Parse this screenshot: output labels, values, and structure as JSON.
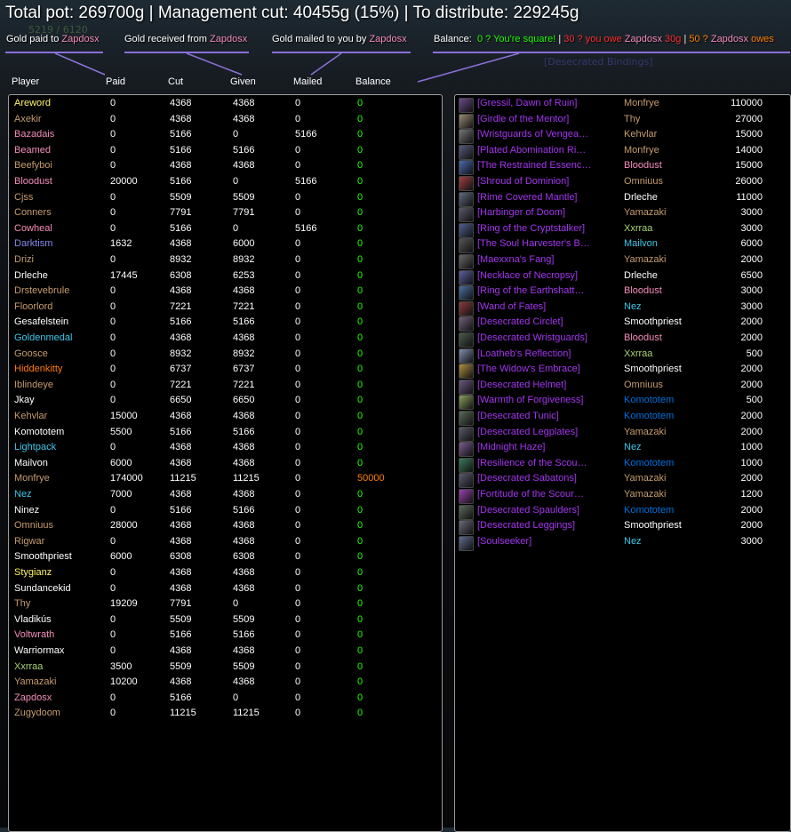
{
  "header": {
    "total_line": "Total pot: 269700g | Management cut: 40455g (15%) | To distribute: 229245g"
  },
  "legend": {
    "paid_label": "Gold paid to",
    "paid_name": "Zapdosx",
    "received_label": "Gold received from",
    "received_name": "Zapdosx",
    "mailed_label": "Gold mailed to you by",
    "mailed_name": "Zapdosx",
    "balance_label": "Balance:",
    "balance_square": "0 ? You're square!",
    "sep1": "|",
    "balance_owe_amount": "30 ? you owe",
    "balance_owe_name": "Zapdosx",
    "balance_owe_value": "30g",
    "sep2": "|",
    "balance_owes_amount": "50 ? ",
    "balance_owes_name": "Zapdosx",
    "balance_owes_word": "owes"
  },
  "faint_text": {
    "top_left": "5219 / 6120",
    "bg_item": "[Desecrated Bindings]"
  },
  "columns": [
    "Player",
    "Paid",
    "Cut",
    "Given",
    "Mailed",
    "Balance"
  ],
  "colors": {
    "legendary_orange": "#ff8000",
    "balance_green": "#1eff00",
    "epic_purple": "#a335ee",
    "panel_border": "#9a9a9a"
  },
  "players": [
    {
      "name": "Areword",
      "color": "#fff468",
      "paid": "0",
      "cut": "4368",
      "given": "4368",
      "mailed": "0",
      "balance": "0"
    },
    {
      "name": "Axekir",
      "color": "#c69b6d",
      "paid": "0",
      "cut": "4368",
      "given": "4368",
      "mailed": "0",
      "balance": "0"
    },
    {
      "name": "Bazadais",
      "color": "#f48cba",
      "paid": "0",
      "cut": "5166",
      "given": "0",
      "mailed": "5166",
      "balance": "0"
    },
    {
      "name": "Beamed",
      "color": "#f48cba",
      "paid": "0",
      "cut": "5166",
      "given": "5166",
      "mailed": "0",
      "balance": "0"
    },
    {
      "name": "Beefyboi",
      "color": "#c69b6d",
      "paid": "0",
      "cut": "4368",
      "given": "4368",
      "mailed": "0",
      "balance": "0"
    },
    {
      "name": "Bloodust",
      "color": "#f48cba",
      "paid": "20000",
      "cut": "5166",
      "given": "0",
      "mailed": "5166",
      "balance": "0"
    },
    {
      "name": "Cjss",
      "color": "#c69b6d",
      "paid": "0",
      "cut": "5509",
      "given": "5509",
      "mailed": "0",
      "balance": "0"
    },
    {
      "name": "Conners",
      "color": "#c69b6d",
      "paid": "0",
      "cut": "7791",
      "given": "7791",
      "mailed": "0",
      "balance": "0"
    },
    {
      "name": "Cowheal",
      "color": "#f48cba",
      "paid": "0",
      "cut": "5166",
      "given": "0",
      "mailed": "5166",
      "balance": "0"
    },
    {
      "name": "Darktism",
      "color": "#8788ee",
      "paid": "1632",
      "cut": "4368",
      "given": "6000",
      "mailed": "0",
      "balance": "0"
    },
    {
      "name": "Drizi",
      "color": "#c69b6d",
      "paid": "0",
      "cut": "8932",
      "given": "8932",
      "mailed": "0",
      "balance": "0"
    },
    {
      "name": "Drleche",
      "color": "#ffffff",
      "paid": "17445",
      "cut": "6308",
      "given": "6253",
      "mailed": "0",
      "balance": "0"
    },
    {
      "name": "Drstevebrule",
      "color": "#c69b6d",
      "paid": "0",
      "cut": "4368",
      "given": "4368",
      "mailed": "0",
      "balance": "0"
    },
    {
      "name": "Floorlord",
      "color": "#c69b6d",
      "paid": "0",
      "cut": "7221",
      "given": "7221",
      "mailed": "0",
      "balance": "0"
    },
    {
      "name": "Gesafelstein",
      "color": "#ffffff",
      "paid": "0",
      "cut": "5166",
      "given": "5166",
      "mailed": "0",
      "balance": "0"
    },
    {
      "name": "Goldenmedal",
      "color": "#3fc7eb",
      "paid": "0",
      "cut": "4368",
      "given": "4368",
      "mailed": "0",
      "balance": "0"
    },
    {
      "name": "Goosce",
      "color": "#c69b6d",
      "paid": "0",
      "cut": "8932",
      "given": "8932",
      "mailed": "0",
      "balance": "0"
    },
    {
      "name": "Hiddenkitty",
      "color": "#ff7c0a",
      "paid": "0",
      "cut": "6737",
      "given": "6737",
      "mailed": "0",
      "balance": "0"
    },
    {
      "name": "Iblindeye",
      "color": "#c69b6d",
      "paid": "0",
      "cut": "7221",
      "given": "7221",
      "mailed": "0",
      "balance": "0"
    },
    {
      "name": "Jkay",
      "color": "#ffffff",
      "paid": "0",
      "cut": "6650",
      "given": "6650",
      "mailed": "0",
      "balance": "0"
    },
    {
      "name": "Kehvlar",
      "color": "#c69b6d",
      "paid": "15000",
      "cut": "4368",
      "given": "4368",
      "mailed": "0",
      "balance": "0"
    },
    {
      "name": "Komototem",
      "color": "#ffffff",
      "paid": "5500",
      "cut": "5166",
      "given": "5166",
      "mailed": "0",
      "balance": "0"
    },
    {
      "name": "Lightpack",
      "color": "#3fc7eb",
      "paid": "0",
      "cut": "4368",
      "given": "4368",
      "mailed": "0",
      "balance": "0"
    },
    {
      "name": "Mailvon",
      "color": "#ffffff",
      "paid": "6000",
      "cut": "4368",
      "given": "4368",
      "mailed": "0",
      "balance": "0"
    },
    {
      "name": "Monfrye",
      "color": "#c69b6d",
      "paid": "174000",
      "cut": "11215",
      "given": "11215",
      "mailed": "0",
      "balance": "50000",
      "balance_color": "#ff8000"
    },
    {
      "name": "Nez",
      "color": "#3fc7eb",
      "paid": "7000",
      "cut": "4368",
      "given": "4368",
      "mailed": "0",
      "balance": "0"
    },
    {
      "name": "Ninez",
      "color": "#ffffff",
      "paid": "0",
      "cut": "5166",
      "given": "5166",
      "mailed": "0",
      "balance": "0"
    },
    {
      "name": "Omniuus",
      "color": "#c69b6d",
      "paid": "28000",
      "cut": "4368",
      "given": "4368",
      "mailed": "0",
      "balance": "0"
    },
    {
      "name": "Rigwar",
      "color": "#c69b6d",
      "paid": "0",
      "cut": "4368",
      "given": "4368",
      "mailed": "0",
      "balance": "0"
    },
    {
      "name": "Smoothpriest",
      "color": "#ffffff",
      "paid": "6000",
      "cut": "6308",
      "given": "6308",
      "mailed": "0",
      "balance": "0"
    },
    {
      "name": "Stygianz",
      "color": "#fff468",
      "paid": "0",
      "cut": "4368",
      "given": "4368",
      "mailed": "0",
      "balance": "0"
    },
    {
      "name": "Sundancekid",
      "color": "#ffffff",
      "paid": "0",
      "cut": "4368",
      "given": "4368",
      "mailed": "0",
      "balance": "0"
    },
    {
      "name": "Thy",
      "color": "#c69b6d",
      "paid": "19209",
      "cut": "7791",
      "given": "0",
      "mailed": "0",
      "balance": "0"
    },
    {
      "name": "Vladikús",
      "color": "#ffffff",
      "paid": "0",
      "cut": "5509",
      "given": "5509",
      "mailed": "0",
      "balance": "0"
    },
    {
      "name": "Voltwrath",
      "color": "#f48cba",
      "paid": "0",
      "cut": "5166",
      "given": "5166",
      "mailed": "0",
      "balance": "0"
    },
    {
      "name": "Warriormax",
      "color": "#ffffff",
      "paid": "0",
      "cut": "4368",
      "given": "4368",
      "mailed": "0",
      "balance": "0"
    },
    {
      "name": "Xxrraa",
      "color": "#aad372",
      "paid": "3500",
      "cut": "5509",
      "given": "5509",
      "mailed": "0",
      "balance": "0"
    },
    {
      "name": "Yamazaki",
      "color": "#c69b6d",
      "paid": "10200",
      "cut": "4368",
      "given": "4368",
      "mailed": "0",
      "balance": "0"
    },
    {
      "name": "Zapdosx",
      "color": "#f48cba",
      "paid": "0",
      "cut": "5166",
      "given": "0",
      "mailed": "0",
      "balance": "0"
    },
    {
      "name": "Zugydoom",
      "color": "#c69b6d",
      "paid": "0",
      "cut": "11215",
      "given": "11215",
      "mailed": "0",
      "balance": "0"
    }
  ],
  "items": [
    {
      "name": "[Gressil, Dawn of Ruin]",
      "icon": "sword-icon",
      "icon_color": "#6a4a8a",
      "owner": "Monfrye",
      "owner_color": "#c69b6d",
      "price": "110000"
    },
    {
      "name": "[Girdle of the Mentor]",
      "icon": "belt-icon",
      "icon_color": "#9a8a70",
      "owner": "Thy",
      "owner_color": "#c69b6d",
      "price": "27000"
    },
    {
      "name": "[Wristguards of Vengea…",
      "icon": "bracer-icon",
      "icon_color": "#777",
      "owner": "Kehvlar",
      "owner_color": "#c69b6d",
      "price": "15000"
    },
    {
      "name": "[Plated Abomination Ri…",
      "icon": "ring-icon",
      "icon_color": "#555a7a",
      "owner": "Monfrye",
      "owner_color": "#c69b6d",
      "price": "14000"
    },
    {
      "name": "[The Restrained Essenc…",
      "icon": "trinket-icon",
      "icon_color": "#4a6ab0",
      "owner": "Bloodust",
      "owner_color": "#f48cba",
      "price": "15000"
    },
    {
      "name": "[Shroud of Dominion]",
      "icon": "cloak-icon",
      "icon_color": "#a04040",
      "owner": "Omniuus",
      "owner_color": "#c69b6d",
      "price": "26000"
    },
    {
      "name": "[Rime Covered Mantle]",
      "icon": "shoulder-icon",
      "icon_color": "#606a80",
      "owner": "Drleche",
      "owner_color": "#ffffff",
      "price": "11000"
    },
    {
      "name": "[Harbinger of Doom]",
      "icon": "dagger-icon",
      "icon_color": "#5a5a6a",
      "owner": "Yamazaki",
      "owner_color": "#c69b6d",
      "price": "3000"
    },
    {
      "name": "[Ring of the Cryptstalker]",
      "icon": "ring-icon",
      "icon_color": "#506090",
      "owner": "Xxrraa",
      "owner_color": "#aad372",
      "price": "3000"
    },
    {
      "name": "[The Soul Harvester's B…",
      "icon": "belt-icon",
      "icon_color": "#555",
      "owner": "Mailvon",
      "owner_color": "#3fc7eb",
      "price": "6000"
    },
    {
      "name": "[Maexxna's Fang]",
      "icon": "dagger-icon",
      "icon_color": "#666",
      "owner": "Yamazaki",
      "owner_color": "#c69b6d",
      "price": "2000"
    },
    {
      "name": "[Necklace of Necropsy]",
      "icon": "necklace-icon",
      "icon_color": "#5a60a0",
      "owner": "Drleche",
      "owner_color": "#ffffff",
      "price": "6500"
    },
    {
      "name": "[Ring of the Earthshatt…",
      "icon": "ring-icon",
      "icon_color": "#4a70a0",
      "owner": "Bloodust",
      "owner_color": "#f48cba",
      "price": "3000"
    },
    {
      "name": "[Wand of Fates]",
      "icon": "wand-icon",
      "icon_color": "#8a3a3a",
      "owner": "Nez",
      "owner_color": "#3fc7eb",
      "price": "3000"
    },
    {
      "name": "[Desecrated Circlet]",
      "icon": "helm-icon",
      "icon_color": "#70607a",
      "owner": "Smoothpriest",
      "owner_color": "#ffffff",
      "price": "2000"
    },
    {
      "name": "[Desecrated Wristguards]",
      "icon": "bracer-icon",
      "icon_color": "#4a5a4a",
      "owner": "Bloodust",
      "owner_color": "#f48cba",
      "price": "2000"
    },
    {
      "name": "[Loatheb's Reflection]",
      "icon": "trinket-icon",
      "icon_color": "#8090b0",
      "owner": "Xxrraa",
      "owner_color": "#aad372",
      "price": "500"
    },
    {
      "name": "[The Widow's Embrace]",
      "icon": "trinket-icon",
      "icon_color": "#b09040",
      "owner": "Smoothpriest",
      "owner_color": "#ffffff",
      "price": "2000"
    },
    {
      "name": "[Desecrated Helmet]",
      "icon": "helm-icon",
      "icon_color": "#6a5a80",
      "owner": "Omniuus",
      "owner_color": "#c69b6d",
      "price": "2000"
    },
    {
      "name": "[Warmth of Forgiveness]",
      "icon": "trinket-icon",
      "icon_color": "#8aa060",
      "owner": "Komototem",
      "owner_color": "#0070dd",
      "price": "500"
    },
    {
      "name": "[Desecrated Tunic]",
      "icon": "chest-icon",
      "icon_color": "#5a6a5a",
      "owner": "Komototem",
      "owner_color": "#0070dd",
      "price": "2000"
    },
    {
      "name": "[Desecrated Legplates]",
      "icon": "legs-icon",
      "icon_color": "#5a5a6a",
      "owner": "Yamazaki",
      "owner_color": "#c69b6d",
      "price": "2000"
    },
    {
      "name": "[Midnight Haze]",
      "icon": "staff-icon",
      "icon_color": "#7a5a90",
      "owner": "Nez",
      "owner_color": "#3fc7eb",
      "price": "1000"
    },
    {
      "name": "[Resilience of the Scou…",
      "icon": "trinket-icon",
      "icon_color": "#3a7a5a",
      "owner": "Komototem",
      "owner_color": "#0070dd",
      "price": "1000"
    },
    {
      "name": "[Desecrated Sabatons]",
      "icon": "boots-icon",
      "icon_color": "#5a5a70",
      "owner": "Yamazaki",
      "owner_color": "#c69b6d",
      "price": "2000"
    },
    {
      "name": "[Fortitude of the Scour…",
      "icon": "trinket-icon",
      "icon_color": "#9a40b0",
      "owner": "Yamazaki",
      "owner_color": "#c69b6d",
      "price": "1200"
    },
    {
      "name": "[Desecrated Spaulders]",
      "icon": "shoulder-icon",
      "icon_color": "#5a6a5a",
      "owner": "Komototem",
      "owner_color": "#0070dd",
      "price": "2000"
    },
    {
      "name": "[Desecrated Leggings]",
      "icon": "legs-icon",
      "icon_color": "#6a6a7a",
      "owner": "Smoothpriest",
      "owner_color": "#ffffff",
      "price": "2000"
    },
    {
      "name": "[Soulseeker]",
      "icon": "staff-icon",
      "icon_color": "#606a90",
      "owner": "Nez",
      "owner_color": "#3fc7eb",
      "price": "3000"
    }
  ]
}
